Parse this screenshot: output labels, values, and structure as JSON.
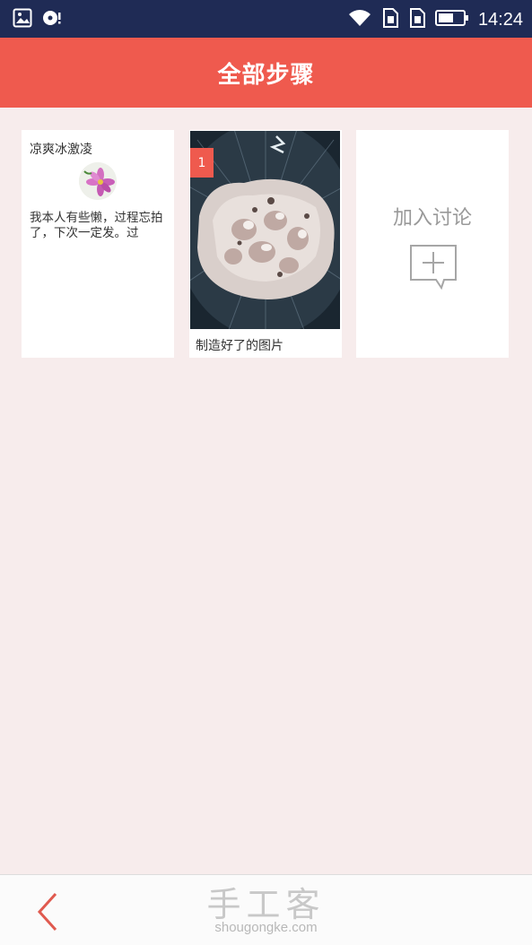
{
  "status_bar": {
    "time": "14:24",
    "icons": [
      "gallery-notification-icon",
      "media-notification-icon",
      "wifi-icon",
      "sim1-icon",
      "sim2-icon",
      "battery-icon"
    ]
  },
  "header": {
    "title": "全部步骤"
  },
  "cards": {
    "intro": {
      "name": "凉爽冰激凌",
      "text": "我本人有些懒，过程忘拍了，下次一定发。过"
    },
    "step": {
      "badge": "1",
      "caption": "制造好了的图片"
    },
    "discussion": {
      "label": "加入讨论",
      "icon": "add-comment-icon"
    }
  },
  "footer": {
    "logo_cn": "手工客",
    "logo_en": "shougongke.com",
    "back_icon": "chevron-left-icon"
  },
  "colors": {
    "status_bar": "#1f2b55",
    "accent": "#ef5a4e",
    "background": "#f7ecec"
  }
}
